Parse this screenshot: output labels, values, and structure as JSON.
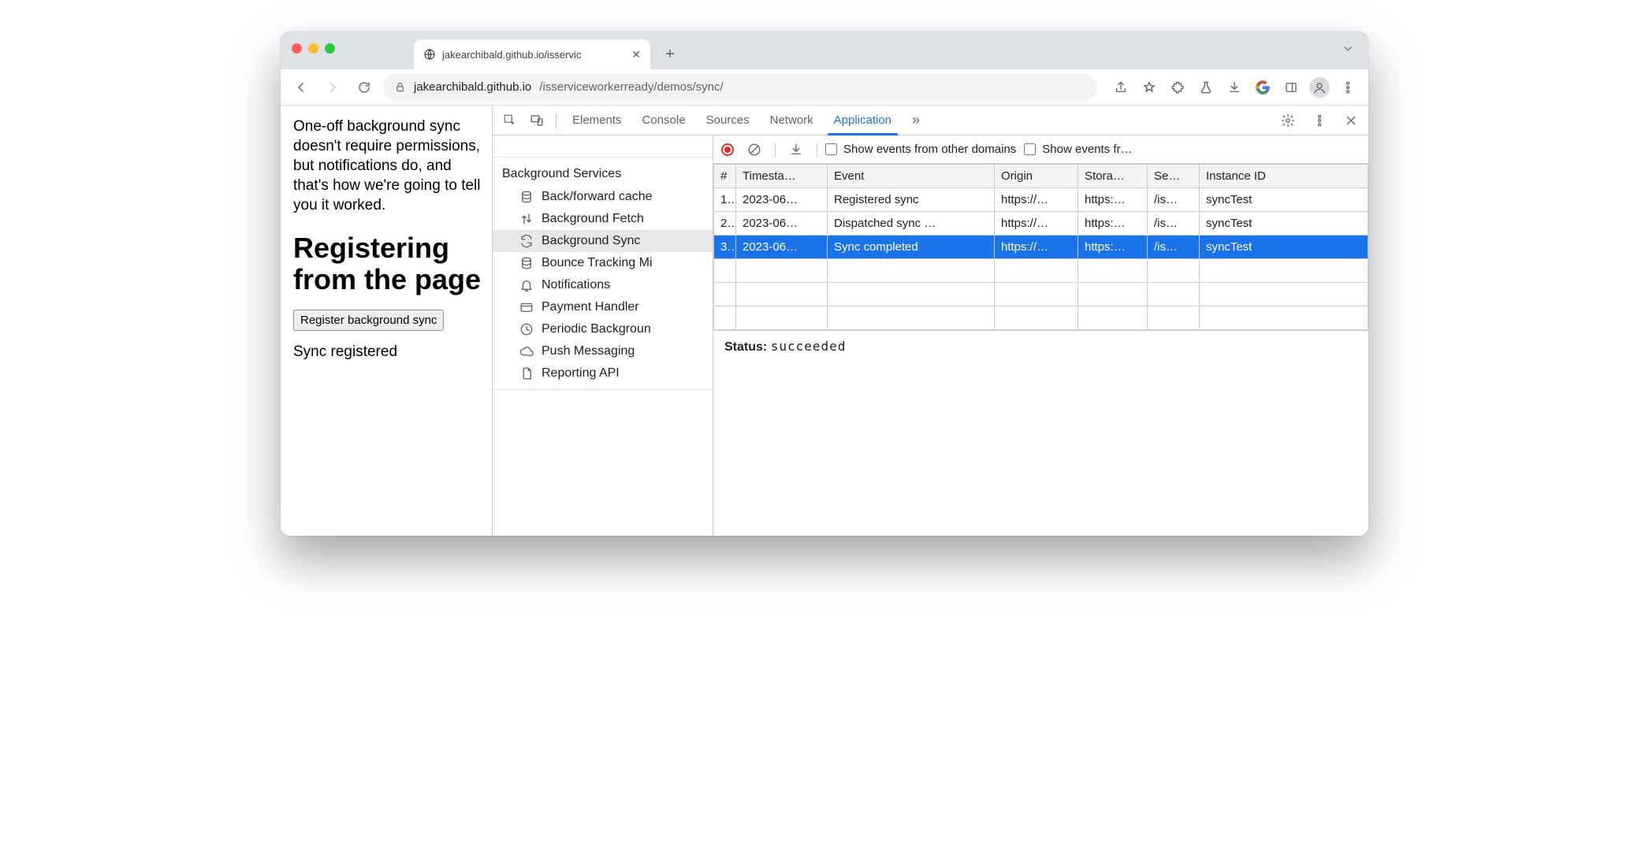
{
  "browser": {
    "tab_title": "jakearchibald.github.io/isservic",
    "url_host": "jakearchibald.github.io",
    "url_path": "/isserviceworkerready/demos/sync/"
  },
  "page": {
    "intro": "One-off background sync doesn't require permissions, but notifications do, and that's how we're going to tell you it worked.",
    "heading": "Registering from the page",
    "button_label": "Register background sync",
    "status": "Sync registered"
  },
  "devtools": {
    "tabs": [
      "Elements",
      "Console",
      "Sources",
      "Network",
      "Application"
    ],
    "active_tab": "Application",
    "more": "»",
    "sidebar": {
      "group": "Background Services",
      "items": [
        {
          "label": "Back/forward cache",
          "icon": "db"
        },
        {
          "label": "Background Fetch",
          "icon": "updown"
        },
        {
          "label": "Background Sync",
          "icon": "sync",
          "selected": true
        },
        {
          "label": "Bounce Tracking Mi",
          "icon": "db"
        },
        {
          "label": "Notifications",
          "icon": "bell"
        },
        {
          "label": "Payment Handler",
          "icon": "card"
        },
        {
          "label": "Periodic Backgroun",
          "icon": "clock"
        },
        {
          "label": "Push Messaging",
          "icon": "cloud"
        },
        {
          "label": "Reporting API",
          "icon": "doc"
        }
      ]
    },
    "toolbar": {
      "checkbox1": "Show events from other domains",
      "checkbox2": "Show events fr…"
    },
    "table": {
      "headers": [
        "#",
        "Timesta…",
        "Event",
        "Origin",
        "Stora…",
        "Se…",
        "Instance ID"
      ],
      "rows": [
        {
          "n": "1.",
          "ts": "2023-06…",
          "event": "Registered sync",
          "origin": "https://…",
          "storage": "https:…",
          "scope": "/is…",
          "instance": "syncTest"
        },
        {
          "n": "2.",
          "ts": "2023-06…",
          "event": "Dispatched sync …",
          "origin": "https://…",
          "storage": "https:…",
          "scope": "/is…",
          "instance": "syncTest"
        },
        {
          "n": "3.",
          "ts": "2023-06…",
          "event": "Sync completed",
          "origin": "https://…",
          "storage": "https:…",
          "scope": "/is…",
          "instance": "syncTest",
          "selected": true
        }
      ]
    },
    "status_label": "Status:",
    "status_value": "succeeded"
  }
}
